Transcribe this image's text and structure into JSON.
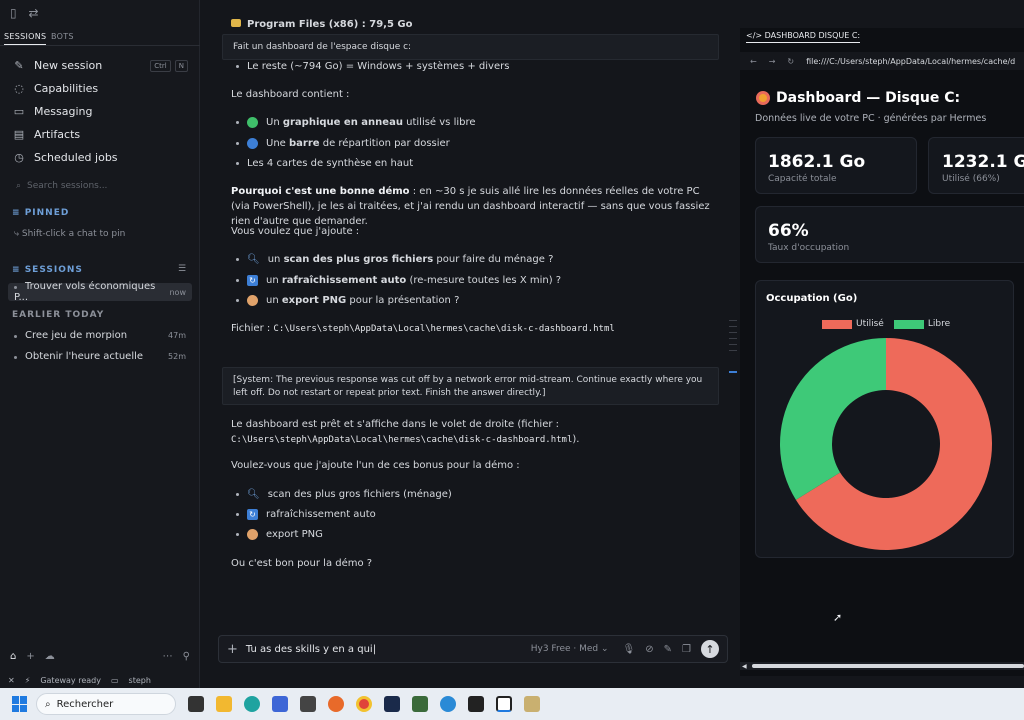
{
  "sidebar": {
    "tabs": [
      "SESSIONS",
      "BOTS"
    ],
    "nav": [
      {
        "label": "New session",
        "icon": "pencil-icon",
        "kbd": [
          "Ctrl",
          "N"
        ]
      },
      {
        "label": "Capabilities",
        "icon": "chat-bubbles-icon"
      },
      {
        "label": "Messaging",
        "icon": "message-icon"
      },
      {
        "label": "Artifacts",
        "icon": "file-icon"
      },
      {
        "label": "Scheduled jobs",
        "icon": "clock-icon"
      }
    ],
    "search_placeholder": "Search sessions...",
    "pinned_title": "PINNED",
    "pinned_hint": "Shift-click a chat to pin",
    "sessions_title": "SESSIONS",
    "current_session": {
      "label": "Trouver vols économiques P...",
      "time": "now"
    },
    "earlier_title": "EARLIER TODAY",
    "earlier": [
      {
        "label": "Cree jeu de morpion",
        "time": "47m"
      },
      {
        "label": "Obtenir l'heure actuelle",
        "time": "52m"
      }
    ]
  },
  "statusbar": {
    "gateway": "Gateway ready",
    "user": "steph"
  },
  "chat": {
    "top_cut": "Program Files (x86) : 79,5 Go",
    "user_msg1": "Fait un dashboard de l'espace disque c:",
    "line_reste": "Le reste (~794 Go) = Windows + systèmes + divers",
    "dash_contient": "Le dashboard contient :",
    "bullets1": [
      {
        "pre": "Un ",
        "bold": "graphique en anneau",
        "post": " utilisé vs libre",
        "color": "#3fbf6a"
      },
      {
        "pre": "Une ",
        "bold": "barre",
        "post": " de répartition par dossier",
        "color": "#3d7fd6"
      },
      {
        "pre": "Les 4 cartes de synthèse en haut",
        "bold": "",
        "post": "",
        "color": ""
      }
    ],
    "pourquoi_bold": "Pourquoi c'est une bonne démo",
    "pourquoi_text": " : en ~30 s je suis allé lire les données réelles de votre PC (via PowerShell), je les ai traitées, et j'ai rendu un dashboard interactif — sans que vous fassiez rien d'autre que demander.",
    "vous_voulez": "Vous voulez que j'ajoute :",
    "bullets2": [
      {
        "pre": "un ",
        "bold": "scan des plus gros fichiers",
        "post": " pour faire du ménage ?",
        "icon": "magnifier-icon"
      },
      {
        "pre": "un ",
        "bold": "rafraîchissement auto",
        "post": " (re-mesure toutes les X min) ?",
        "icon": "refresh-icon"
      },
      {
        "pre": "un ",
        "bold": "export PNG",
        "post": " pour la présentation ?",
        "icon": "palette-icon"
      }
    ],
    "fichier_label": "Fichier : ",
    "fichier_path": "C:\\Users\\steph\\AppData\\Local\\hermes\\cache\\disk-c-dashboard.html",
    "system_msg": "[System: The previous response was cut off by a network error mid-stream. Continue exactly where you left off. Do not restart or repeat prior text. Finish the answer directly.]",
    "pret_text": "Le dashboard est prêt et s'affiche dans le volet de droite (fichier :",
    "pret_path": "C:\\Users\\steph\\AppData\\Local\\hermes\\cache\\disk-c-dashboard.html",
    "pret_end": ").",
    "bonus_q": "Voulez-vous que j'ajoute l'un de ces bonus pour la démo :",
    "bullets3": [
      {
        "label": "scan des plus gros fichiers (ménage)",
        "icon": "magnifier-icon"
      },
      {
        "label": "rafraîchissement auto",
        "icon": "refresh-icon"
      },
      {
        "label": "export PNG",
        "icon": "palette-icon"
      }
    ],
    "final_q": "Ou c'est bon pour la démo ?",
    "input_value": "Tu as des skills y en a qui",
    "model": "Hy3 Free · Med"
  },
  "pane": {
    "tab_label": "DASHBOARD DISQUE C:",
    "url": "file:///C:/Users/steph/AppData/Local/hermes/cache/d",
    "title": "Dashboard — Disque C:",
    "subtitle": "Données live de votre PC · générées par Hermes",
    "cards": [
      {
        "value": "1862.1 Go",
        "label": "Capacité totale"
      },
      {
        "value": "1232.1 Go",
        "label": "Utilisé (66%)"
      },
      {
        "value": "66%",
        "label": "Taux d'occupation"
      }
    ],
    "chart_title": "Occupation (Go)"
  },
  "chart_data": {
    "type": "pie",
    "title": "Occupation (Go)",
    "series": [
      {
        "name": "Utilisé",
        "value": 1232.1,
        "color": "#ee6a5a"
      },
      {
        "name": "Libre",
        "value": 630.0,
        "color": "#3ec978"
      }
    ],
    "legend": "top"
  },
  "taskbar": {
    "search_label": "Rechercher"
  }
}
